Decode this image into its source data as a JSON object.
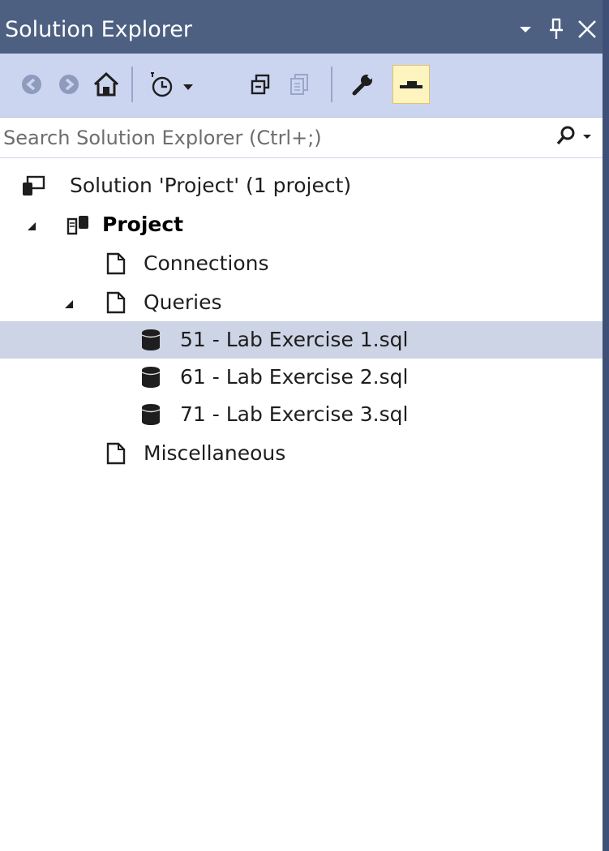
{
  "window": {
    "title": "Solution Explorer",
    "icons": [
      "dropdown-arrow-icon",
      "pin-icon",
      "close-icon"
    ]
  },
  "toolbar": {
    "buttons": [
      {
        "name": "back-button",
        "icon": "back-arrow-icon",
        "enabled": false
      },
      {
        "name": "forward-button",
        "icon": "forward-arrow-icon",
        "enabled": false
      },
      {
        "name": "home-button",
        "icon": "home-icon",
        "enabled": true
      },
      {
        "name": "pending-changes-filter-button",
        "icon": "clock-filter-icon",
        "enabled": true
      },
      {
        "name": "collapse-all-button",
        "icon": "collapse-all-icon",
        "enabled": true
      },
      {
        "name": "show-all-files-button",
        "icon": "copy-icon",
        "enabled": false
      },
      {
        "name": "properties-button",
        "icon": "wrench-icon",
        "enabled": true
      },
      {
        "name": "preview-selected-button",
        "icon": "preview-icon",
        "enabled": true,
        "active": true
      }
    ]
  },
  "search": {
    "placeholder": "Search Solution Explorer (Ctrl+;)"
  },
  "tree": {
    "solution": "Solution 'Project' (1 project)",
    "project": "Project",
    "connections": "Connections",
    "queries": "Queries",
    "query_files": [
      "51 - Lab Exercise 1.sql",
      "61 - Lab Exercise 2.sql",
      "71 - Lab Exercise 3.sql"
    ],
    "miscellaneous": "Miscellaneous",
    "selected": "51 - Lab Exercise 1.sql"
  },
  "colors": {
    "titlebar": "#4d6082",
    "toolbar": "#ccd5f0",
    "selection": "#ccd4e6",
    "active_button": "#fdf4bf"
  }
}
